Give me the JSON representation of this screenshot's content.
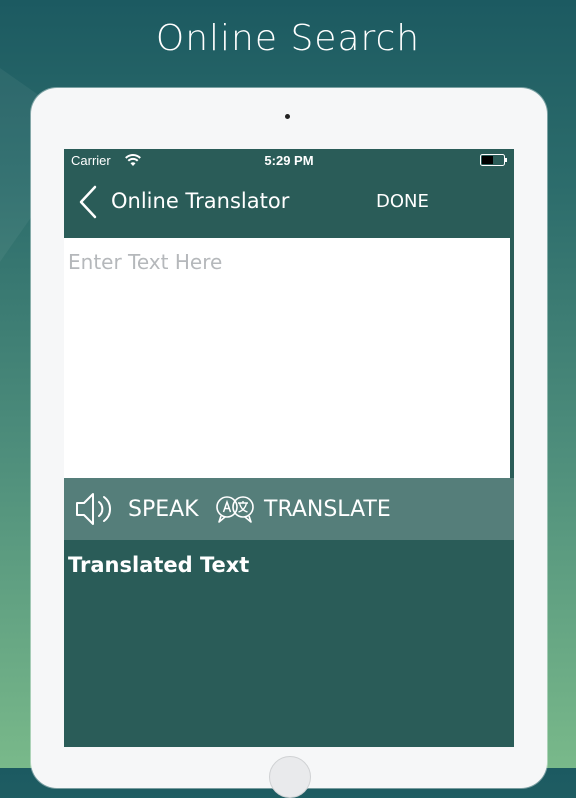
{
  "marketing": {
    "title": "Online Search"
  },
  "status_bar": {
    "carrier": "Carrier",
    "time": "5:29 PM"
  },
  "nav": {
    "title": "Online Translator",
    "done_label": "DONE"
  },
  "input": {
    "placeholder": "Enter Text Here",
    "value": ""
  },
  "actions": {
    "speak_label": "SPEAK",
    "translate_label": "TRANSLATE"
  },
  "output": {
    "label": "Translated Text"
  },
  "icons": {
    "back": "chevron-left-icon",
    "wifi": "wifi-icon",
    "battery": "battery-icon",
    "speak": "speaker-icon",
    "translate": "translate-icon"
  },
  "colors": {
    "screen_bg": "#2a5c58",
    "action_bar_bg": "#557e7a",
    "input_bg": "#ffffff"
  }
}
